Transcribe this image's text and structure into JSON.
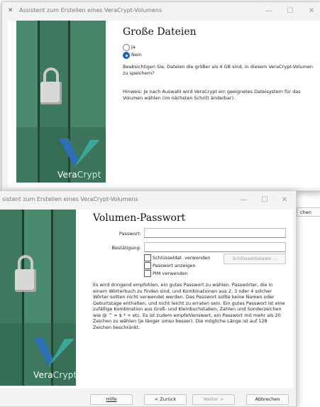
{
  "window1": {
    "title": "Assistent zum Erstellen eines VeraCrypt-Volumens",
    "heading": "Große Dateien",
    "options": [
      "Ja",
      "Nein"
    ],
    "selected_option": "Nein",
    "question": "Beabsichtigen Sie, Dateien die größer als 4 GB sind, in diesem VeraCrypt-Volumen zu speichern?",
    "hint": "Hinweis: Je nach Auswahl wird VeraCrypt ein geeignetes Dateisystem für das Volumen wählen (im nächsten Schritt änderbar).",
    "logo_vera": "Vera",
    "logo_crypt": "Crypt",
    "peek_button_label": "chen"
  },
  "window2": {
    "title": "sistent zum Erstellen eines VeraCrypt-Volumens",
    "heading": "Volumen-Passwort",
    "password_label": "Passwort:",
    "password_value": "",
    "confirm_label": "Bestätigung:",
    "confirm_value": "",
    "use_keyfiles_label": "Schlüsseldat. verwenden",
    "show_password_label": "Passwort anzeigen",
    "use_pim_label": "PIM verwenden",
    "keyfiles_button": "Schlüsseldateien ...",
    "info": "Es wird dringend empfohlen, ein gutes Passwort zu wählen. Passwörter, die in einem Wörterbuch zu finden sind, und Kombinationen aus 2, 3 oder 4 solcher Wörter sollten nicht verwendet werden. Das Passwort sollte keine Namen oder Geburtstage enthalten, und nicht leicht zu erraten sein. Ein gutes Passwort ist eine zufällige Kombination aus Groß- und Kleinbuchstaben, Zahlen und Sonderzeichen wie @ ^ = $ * + etc. Es ist zudem empfehlenswert, ein Passwort mit mehr als 20 Zeichen zu wählen (je länger umso besser). Die mögliche Länge ist auf 128 Zeichen beschränkt.",
    "logo_vera": "Vera",
    "logo_crypt": "Crypt",
    "buttons": {
      "help": "Hilfe",
      "back": "< Zurück",
      "next": "Weiter >",
      "cancel": "Abbrechen"
    }
  },
  "colors": {
    "accent": "#1b63c6",
    "wood": "#3f7a62",
    "logo_blue": "#2f6fb5",
    "logo_teal": "#3aa79a"
  }
}
